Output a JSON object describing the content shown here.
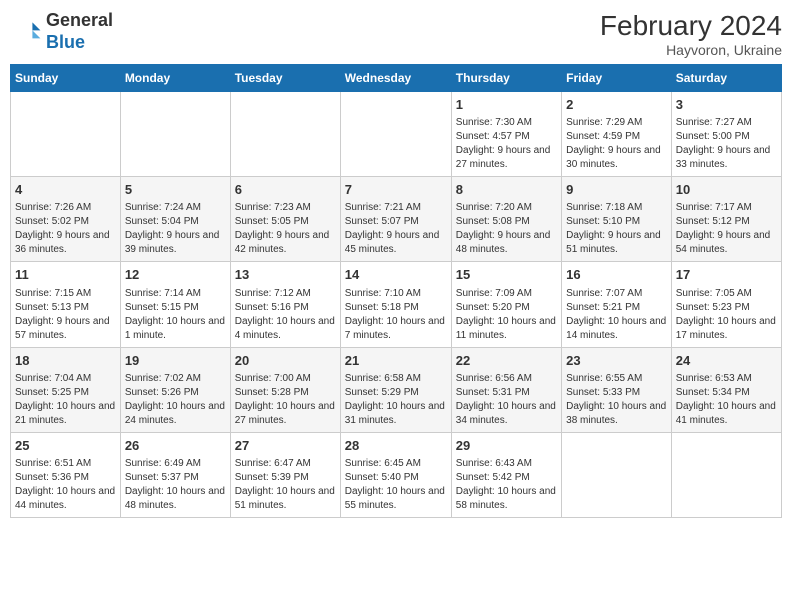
{
  "header": {
    "logo_line1": "General",
    "logo_line2": "Blue",
    "main_title": "February 2024",
    "subtitle": "Hayvoron, Ukraine"
  },
  "columns": [
    "Sunday",
    "Monday",
    "Tuesday",
    "Wednesday",
    "Thursday",
    "Friday",
    "Saturday"
  ],
  "weeks": [
    {
      "cells": [
        {
          "day": "",
          "info": ""
        },
        {
          "day": "",
          "info": ""
        },
        {
          "day": "",
          "info": ""
        },
        {
          "day": "",
          "info": ""
        },
        {
          "day": "1",
          "info": "Sunrise: 7:30 AM\nSunset: 4:57 PM\nDaylight: 9 hours and 27 minutes."
        },
        {
          "day": "2",
          "info": "Sunrise: 7:29 AM\nSunset: 4:59 PM\nDaylight: 9 hours and 30 minutes."
        },
        {
          "day": "3",
          "info": "Sunrise: 7:27 AM\nSunset: 5:00 PM\nDaylight: 9 hours and 33 minutes."
        }
      ]
    },
    {
      "cells": [
        {
          "day": "4",
          "info": "Sunrise: 7:26 AM\nSunset: 5:02 PM\nDaylight: 9 hours and 36 minutes."
        },
        {
          "day": "5",
          "info": "Sunrise: 7:24 AM\nSunset: 5:04 PM\nDaylight: 9 hours and 39 minutes."
        },
        {
          "day": "6",
          "info": "Sunrise: 7:23 AM\nSunset: 5:05 PM\nDaylight: 9 hours and 42 minutes."
        },
        {
          "day": "7",
          "info": "Sunrise: 7:21 AM\nSunset: 5:07 PM\nDaylight: 9 hours and 45 minutes."
        },
        {
          "day": "8",
          "info": "Sunrise: 7:20 AM\nSunset: 5:08 PM\nDaylight: 9 hours and 48 minutes."
        },
        {
          "day": "9",
          "info": "Sunrise: 7:18 AM\nSunset: 5:10 PM\nDaylight: 9 hours and 51 minutes."
        },
        {
          "day": "10",
          "info": "Sunrise: 7:17 AM\nSunset: 5:12 PM\nDaylight: 9 hours and 54 minutes."
        }
      ]
    },
    {
      "cells": [
        {
          "day": "11",
          "info": "Sunrise: 7:15 AM\nSunset: 5:13 PM\nDaylight: 9 hours and 57 minutes."
        },
        {
          "day": "12",
          "info": "Sunrise: 7:14 AM\nSunset: 5:15 PM\nDaylight: 10 hours and 1 minute."
        },
        {
          "day": "13",
          "info": "Sunrise: 7:12 AM\nSunset: 5:16 PM\nDaylight: 10 hours and 4 minutes."
        },
        {
          "day": "14",
          "info": "Sunrise: 7:10 AM\nSunset: 5:18 PM\nDaylight: 10 hours and 7 minutes."
        },
        {
          "day": "15",
          "info": "Sunrise: 7:09 AM\nSunset: 5:20 PM\nDaylight: 10 hours and 11 minutes."
        },
        {
          "day": "16",
          "info": "Sunrise: 7:07 AM\nSunset: 5:21 PM\nDaylight: 10 hours and 14 minutes."
        },
        {
          "day": "17",
          "info": "Sunrise: 7:05 AM\nSunset: 5:23 PM\nDaylight: 10 hours and 17 minutes."
        }
      ]
    },
    {
      "cells": [
        {
          "day": "18",
          "info": "Sunrise: 7:04 AM\nSunset: 5:25 PM\nDaylight: 10 hours and 21 minutes."
        },
        {
          "day": "19",
          "info": "Sunrise: 7:02 AM\nSunset: 5:26 PM\nDaylight: 10 hours and 24 minutes."
        },
        {
          "day": "20",
          "info": "Sunrise: 7:00 AM\nSunset: 5:28 PM\nDaylight: 10 hours and 27 minutes."
        },
        {
          "day": "21",
          "info": "Sunrise: 6:58 AM\nSunset: 5:29 PM\nDaylight: 10 hours and 31 minutes."
        },
        {
          "day": "22",
          "info": "Sunrise: 6:56 AM\nSunset: 5:31 PM\nDaylight: 10 hours and 34 minutes."
        },
        {
          "day": "23",
          "info": "Sunrise: 6:55 AM\nSunset: 5:33 PM\nDaylight: 10 hours and 38 minutes."
        },
        {
          "day": "24",
          "info": "Sunrise: 6:53 AM\nSunset: 5:34 PM\nDaylight: 10 hours and 41 minutes."
        }
      ]
    },
    {
      "cells": [
        {
          "day": "25",
          "info": "Sunrise: 6:51 AM\nSunset: 5:36 PM\nDaylight: 10 hours and 44 minutes."
        },
        {
          "day": "26",
          "info": "Sunrise: 6:49 AM\nSunset: 5:37 PM\nDaylight: 10 hours and 48 minutes."
        },
        {
          "day": "27",
          "info": "Sunrise: 6:47 AM\nSunset: 5:39 PM\nDaylight: 10 hours and 51 minutes."
        },
        {
          "day": "28",
          "info": "Sunrise: 6:45 AM\nSunset: 5:40 PM\nDaylight: 10 hours and 55 minutes."
        },
        {
          "day": "29",
          "info": "Sunrise: 6:43 AM\nSunset: 5:42 PM\nDaylight: 10 hours and 58 minutes."
        },
        {
          "day": "",
          "info": ""
        },
        {
          "day": "",
          "info": ""
        }
      ]
    }
  ]
}
